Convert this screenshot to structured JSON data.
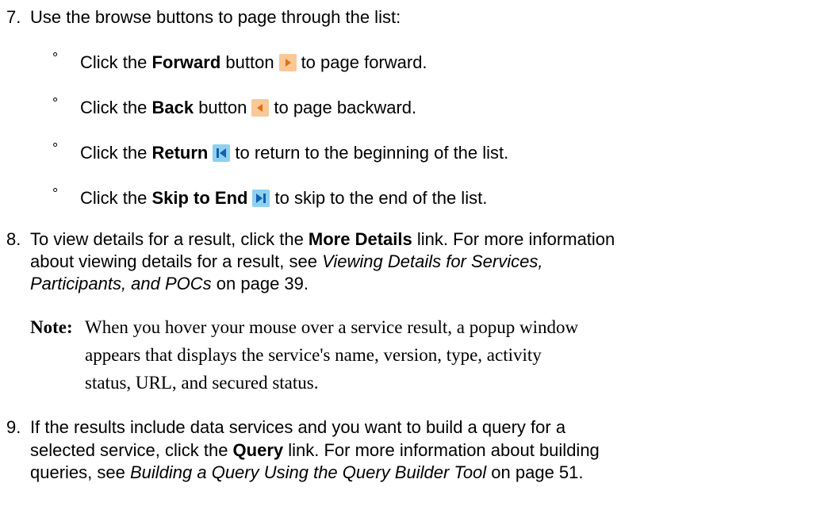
{
  "step7": {
    "number": "7.",
    "text": "Use the browse buttons to page through the list:",
    "bullets": [
      {
        "mark": "°",
        "pre": "Click the ",
        "bold": "Forward",
        "mid": " button",
        "icon": "forward-icon",
        "post": "to page forward."
      },
      {
        "mark": "°",
        "pre": "Click the ",
        "bold": "Back",
        "mid": " button",
        "icon": "back-icon",
        "post": "to page backward."
      },
      {
        "mark": "°",
        "pre": "Click the ",
        "bold": "Return",
        "mid": "",
        "icon": "return-to-start-icon",
        "post": "to return to the beginning of the list."
      },
      {
        "mark": "°",
        "pre": "Click the ",
        "bold": "Skip to End",
        "mid": "",
        "icon": "skip-to-end-icon",
        "post": "to skip to the end of the list."
      }
    ]
  },
  "step8": {
    "number": "8.",
    "line1_pre": "To view details for a result, click the ",
    "line1_bold": "More Details",
    "line1_post": " link. For more information",
    "line2_pre": "about viewing details for a result, see ",
    "line2_italic": "Viewing Details for Services,",
    "line3_italic": "Participants, and POCs",
    "line3_post": " on page 39."
  },
  "note": {
    "label": "Note:",
    "line1": "When you hover your mouse over a service result, a popup window",
    "line2": "appears that displays the service's name, version, type, activity",
    "line3": "status, URL, and secured status."
  },
  "step9": {
    "number": "9.",
    "line1": "If the results include data services and you want to build a query for a",
    "line2_pre": "selected service, click the ",
    "line2_bold": "Query",
    "line2_post": " link. For more information about building",
    "line3_pre": "queries, see ",
    "line3_italic": "Building a Query Using the Query Builder Tool",
    "line3_post": " on page 51."
  },
  "colors": {
    "orange_button": "#f8c898",
    "blue_button": "#8fd0f0",
    "arrow_orange": "#e07010",
    "arrow_blue": "#1060b0"
  }
}
